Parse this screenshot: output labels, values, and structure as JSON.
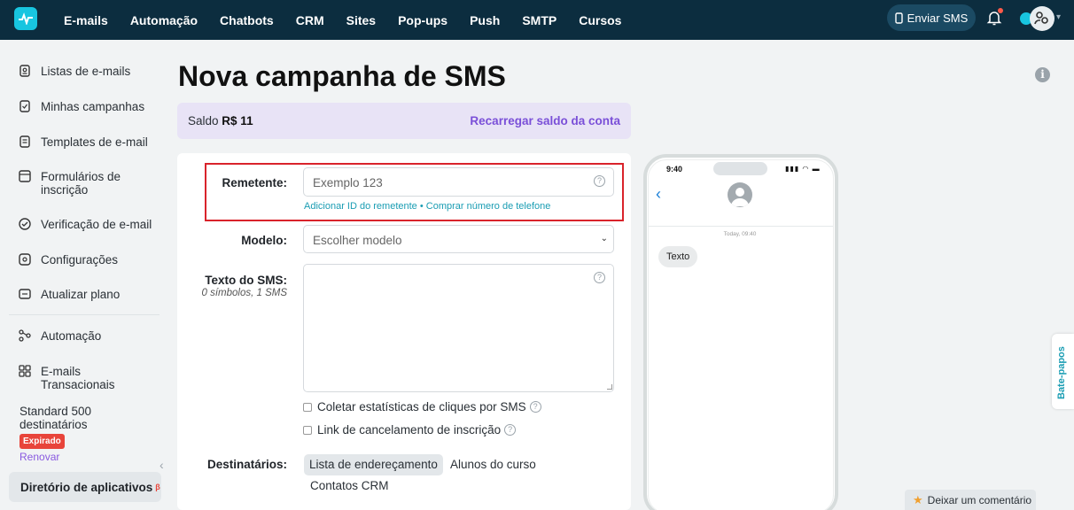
{
  "topbar": {
    "nav": [
      "E-mails",
      "Automação",
      "Chatbots",
      "CRM",
      "Sites",
      "Pop-ups",
      "Push",
      "SMTP",
      "Cursos"
    ],
    "send_sms": "Enviar SMS"
  },
  "sidebar": {
    "items": [
      {
        "label": "Listas de e-mails",
        "icon": "contacts-icon"
      },
      {
        "label": "Minhas campanhas",
        "icon": "campaigns-icon"
      },
      {
        "label": "Templates de e-mail",
        "icon": "template-icon"
      },
      {
        "label": "Formulários de inscrição",
        "icon": "form-icon"
      },
      {
        "label": "Verificação de e-mail",
        "icon": "check-circle-icon"
      },
      {
        "label": "Configurações",
        "icon": "settings-icon"
      },
      {
        "label": "Atualizar plano",
        "icon": "upgrade-icon"
      },
      {
        "label": "Automação",
        "icon": "automation-icon"
      },
      {
        "label": "E-mails Transacionais",
        "icon": "transactional-icon"
      }
    ],
    "plan": {
      "name": "Standard 500 destinatários",
      "status": "Expirado",
      "renew": "Renovar"
    },
    "app_directory": "Diretório de aplicativos",
    "app_directory_badge": "β"
  },
  "main": {
    "title": "Nova campanha de SMS",
    "balance": {
      "label": "Saldo",
      "amount": "R$ 11",
      "recharge": "Recarregar saldo da conta"
    },
    "form": {
      "sender_label": "Remetente:",
      "sender_placeholder": "Exemplo 123",
      "sender_links": "Adicionar ID do remetente • Comprar número de telefone",
      "model_label": "Modelo:",
      "model_value": "Escolher modelo",
      "sms_text_label": "Texto do SMS:",
      "sms_text_counter": "0 símbolos, 1 SMS",
      "collect_stats": "Coletar estatísticas de cliques por SMS",
      "unsubscribe_link": "Link de cancelamento de inscrição",
      "recipients_label": "Destinatários:",
      "recipient_tabs": [
        "Lista de endereçamento",
        "Alunos do curso",
        "Contatos CRM"
      ]
    }
  },
  "phone_preview": {
    "time": "9:40",
    "date": "Today, 09:40",
    "message": "Texto"
  },
  "widgets": {
    "chats": "Bate-papos",
    "feedback": "Deixar um comentário"
  }
}
